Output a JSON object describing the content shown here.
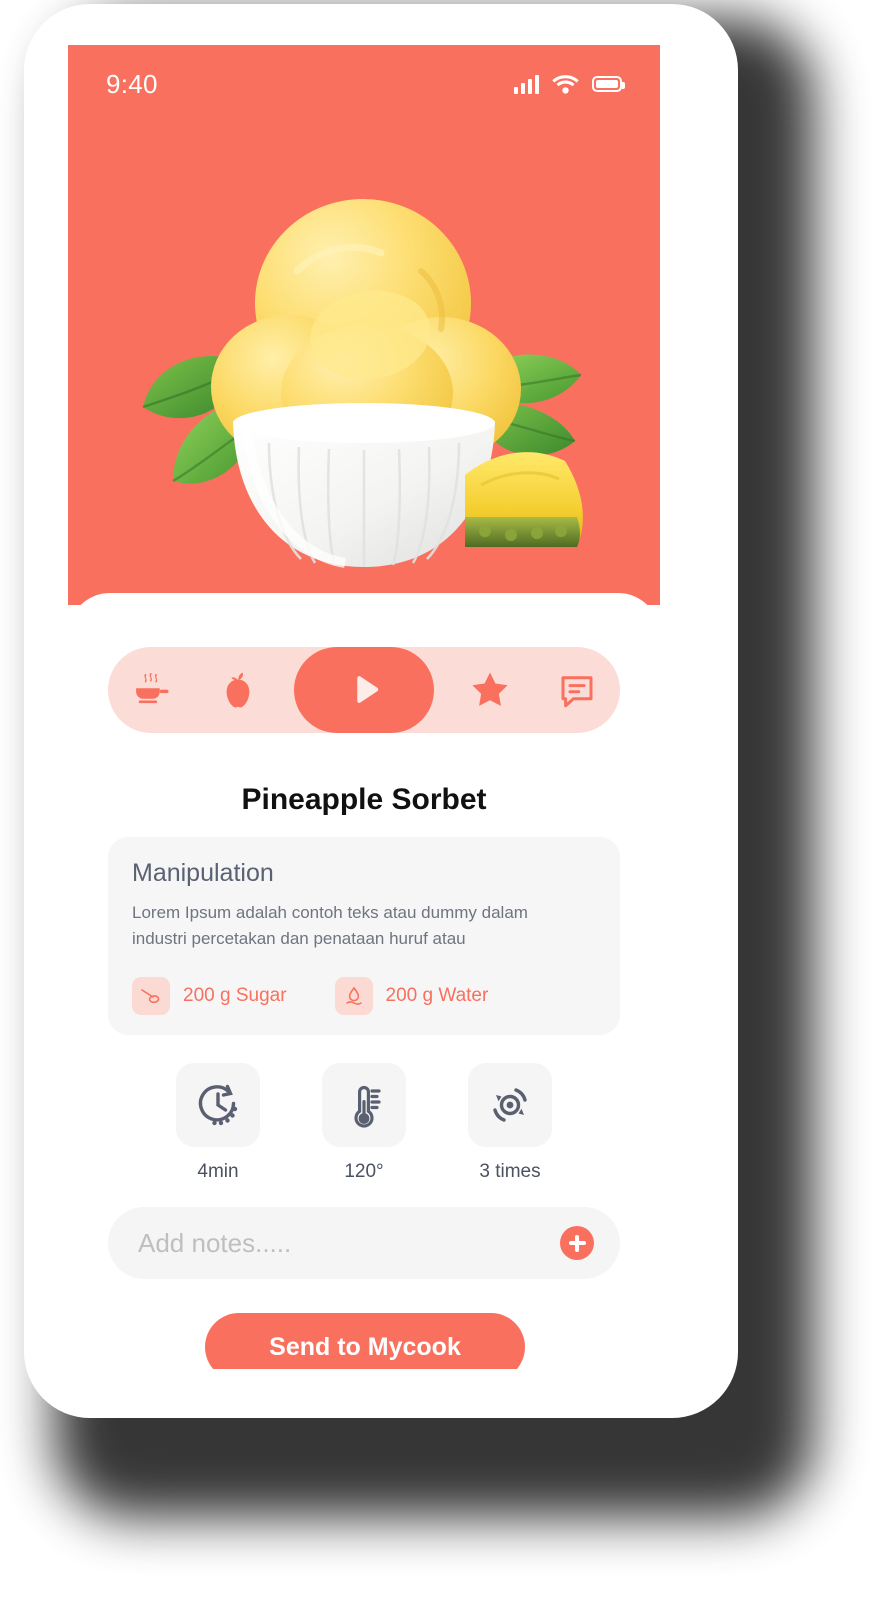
{
  "statusbar": {
    "time": "9:40",
    "signal_icon": "cellular-signal-icon",
    "wifi_icon": "wifi-icon",
    "battery_icon": "battery-icon"
  },
  "hero": {
    "background_color": "#F9705F",
    "image_alt": "pineapple-sorbet-bowl"
  },
  "tabbar": {
    "background_color": "#FCDCD6",
    "active_color": "#F9705F",
    "items": [
      {
        "name": "cooking-pan-icon",
        "label": "Cook",
        "active": false
      },
      {
        "name": "apple-icon",
        "label": "Ingredients",
        "active": false
      },
      {
        "name": "play-icon",
        "label": "Play",
        "active": true
      },
      {
        "name": "star-icon",
        "label": "Favorites",
        "active": false
      },
      {
        "name": "chat-icon",
        "label": "Comments",
        "active": false
      }
    ]
  },
  "recipe": {
    "title": "Pineapple Sorbet"
  },
  "manipulation": {
    "heading": "Manipulation",
    "description": "Lorem Ipsum adalah contoh teks atau dummy dalam industri percetakan dan penataan huruf atau",
    "ingredients": [
      {
        "icon": "spoon-icon",
        "label": "200 g Sugar"
      },
      {
        "icon": "water-drop-icon",
        "label": "200 g Water"
      }
    ]
  },
  "metrics": [
    {
      "icon": "clock-icon",
      "label": "4min"
    },
    {
      "icon": "thermometer-icon",
      "label": "120°"
    },
    {
      "icon": "rotation-icon",
      "label": "3 times"
    }
  ],
  "notes": {
    "placeholder": "Add notes.....",
    "value": "",
    "add_icon": "plus-icon"
  },
  "cta": {
    "label": "Send to Mycook",
    "color": "#F9705F"
  }
}
